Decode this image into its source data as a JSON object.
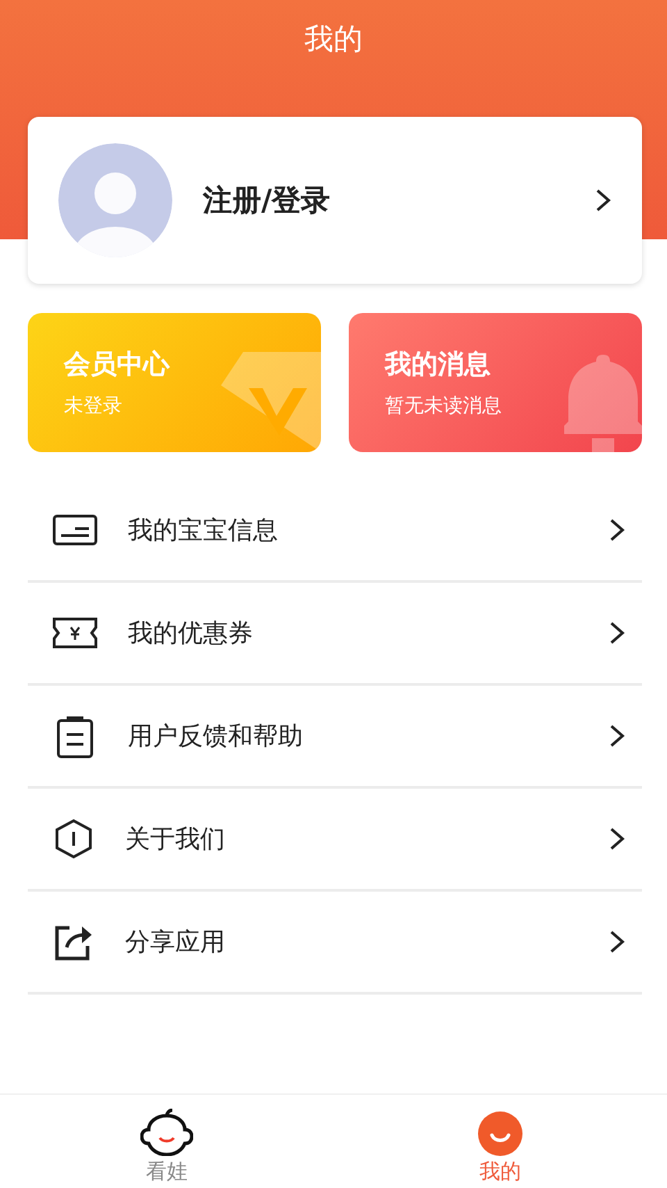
{
  "header": {
    "title": "我的"
  },
  "profile": {
    "label": "注册/登录"
  },
  "promos": [
    {
      "kind": "vip",
      "title": "会员中心",
      "subtitle": "未登录"
    },
    {
      "kind": "message",
      "title": "我的消息",
      "subtitle": "暂无未读消息"
    }
  ],
  "menu": [
    {
      "kind": "card",
      "label": "我的宝宝信息"
    },
    {
      "kind": "coupon",
      "label": "我的优惠券"
    },
    {
      "kind": "clipboard",
      "label": "用户反馈和帮助"
    },
    {
      "kind": "about",
      "label": "关于我们"
    },
    {
      "kind": "share",
      "label": "分享应用"
    }
  ],
  "tabs": [
    {
      "label": "看娃",
      "selected": false
    },
    {
      "label": "我的",
      "selected": true
    }
  ]
}
